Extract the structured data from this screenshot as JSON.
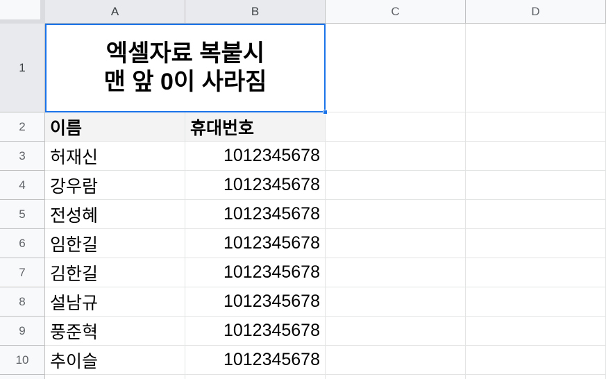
{
  "columns": [
    "A",
    "B",
    "C",
    "D"
  ],
  "rows": [
    "1",
    "2",
    "3",
    "4",
    "5",
    "6",
    "7",
    "8",
    "9",
    "10"
  ],
  "title_cell": {
    "line1": "엑셀자료 복붙시",
    "line2": "맨 앞 0이 사라짐"
  },
  "header_row": {
    "name": "이름",
    "phone": "휴대번호"
  },
  "data_rows": [
    {
      "name": "허재신",
      "phone": "1012345678"
    },
    {
      "name": "강우람",
      "phone": "1012345678"
    },
    {
      "name": "전성혜",
      "phone": "1012345678"
    },
    {
      "name": "임한길",
      "phone": "1012345678"
    },
    {
      "name": "김한길",
      "phone": "1012345678"
    },
    {
      "name": "설남규",
      "phone": "1012345678"
    },
    {
      "name": "풍준혁",
      "phone": "1012345678"
    },
    {
      "name": "추이슬",
      "phone": "1012345678"
    }
  ],
  "colors": {
    "selection": "#1a73e8",
    "header_bg": "#f8f9fa",
    "gridline": "#e2e3e3"
  }
}
